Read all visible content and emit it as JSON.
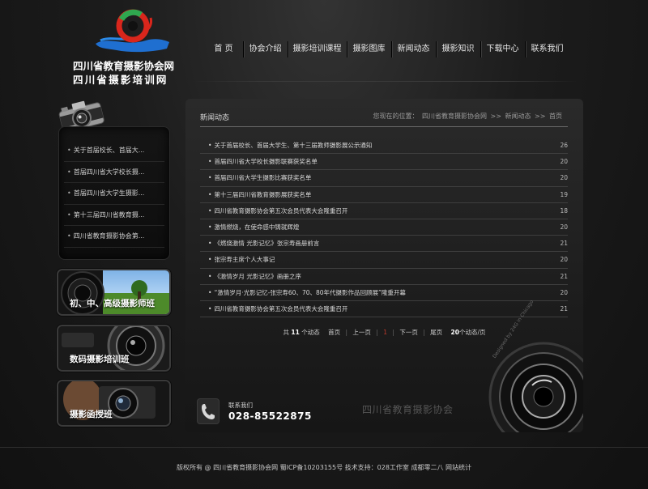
{
  "site": {
    "name_line1": "四川省教育摄影协会网",
    "name_line2": "四川省摄影培训网"
  },
  "nav": {
    "items": [
      {
        "label": "首 页",
        "width": 48
      },
      {
        "label": "协会介绍",
        "width": 55
      },
      {
        "label": "摄影培训课程",
        "width": 73
      },
      {
        "label": "摄影图库",
        "width": 55
      },
      {
        "label": "新闻动态",
        "width": 55
      },
      {
        "label": "摄影知识",
        "width": 55
      },
      {
        "label": "下载中心",
        "width": 55
      },
      {
        "label": "联系我们",
        "width": 55
      }
    ]
  },
  "sidebar": {
    "items": [
      "关于首届校长、首届大...",
      "首届四川省大学校长摄...",
      "首届四川省大学生摄影...",
      "第十三届四川省教育摄...",
      "四川省教育摄影协会第..."
    ],
    "banners": [
      "初、中、高级摄影师班",
      "数码摄影培训班",
      "摄影函授班"
    ]
  },
  "main": {
    "title": "新闻动态",
    "breadcrumb": {
      "prefix": "您现在的位置：",
      "home": "四川省教育摄影协会网",
      "sep": ">>",
      "section": "新闻动态",
      "current": "首页"
    },
    "news": [
      {
        "title": "关于首届校长、首届大学生、第十三届教师摄影展公示通知",
        "count": "26"
      },
      {
        "title": "首届四川省大学校长摄影联赛获奖名单",
        "count": "20"
      },
      {
        "title": "首届四川省大学生摄影比赛获奖名单",
        "count": "20"
      },
      {
        "title": "第十三届四川省教育摄影展获奖名单",
        "count": "19"
      },
      {
        "title": "四川省教育摄影协会第五次会员代表大会隆重召开",
        "count": "18"
      },
      {
        "title": "激情燃烧，在使命感中铸就辉煌",
        "count": "20"
      },
      {
        "title": "《燃烧激情 光影记忆》张宗寿画册前言",
        "count": "21"
      },
      {
        "title": "张宗寿主席个人大事记",
        "count": "20"
      },
      {
        "title": "《激情岁月 光影记忆》画册之序",
        "count": "21"
      },
      {
        "title": "“激情岁月·光影记忆-张宗寿60、70、80年代摄影作品回顾展”隆重开幕",
        "count": "20"
      },
      {
        "title": "四川省教育摄影协会第五次会员代表大会隆重召开",
        "count": "21"
      }
    ],
    "pager": {
      "total_prefix": "共",
      "total": "11",
      "total_suffix": "个动态",
      "first": "首页",
      "prev": "上一页",
      "current": "1",
      "next": "下一页",
      "last": "尾页",
      "per_page": "20",
      "per_page_suffix": "个动态/页"
    },
    "contact": {
      "label": "联系我们",
      "phone": "028-85522875"
    },
    "watermark": "四川省教育摄影协会",
    "designed_by": "Designed by 24G in Chicago"
  },
  "footer": {
    "text": "版权所有 @ 四川省教育摄影协会网 蜀ICP备10203155号 技术支持：028工作室 成都零二八 网站统计"
  },
  "colors": {
    "background": "#1a1a1a",
    "text": "#cfcfcf",
    "current_page": "#c0392b"
  }
}
